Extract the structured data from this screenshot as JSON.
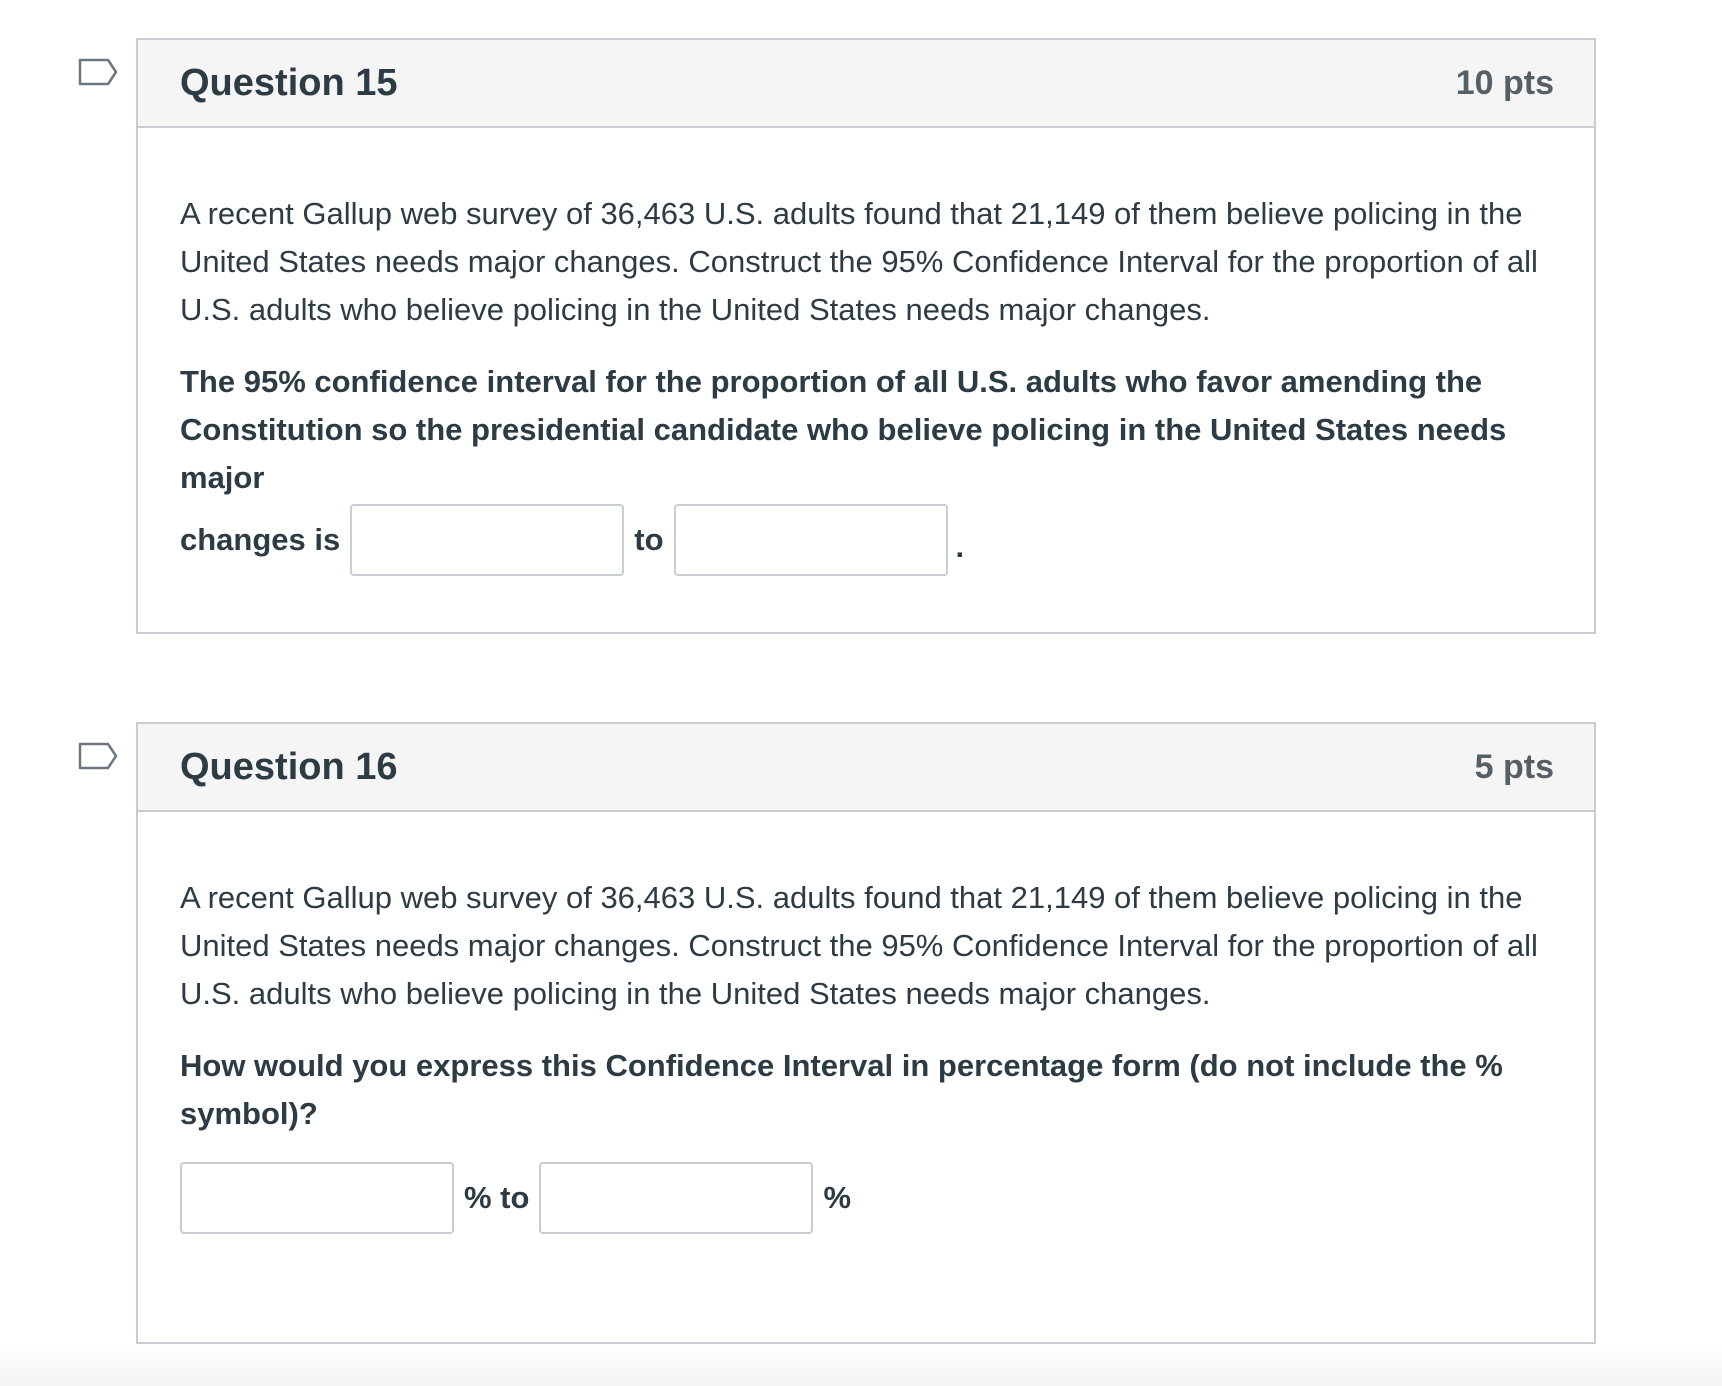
{
  "questions": [
    {
      "title": "Question 15",
      "points": "10 pts",
      "text": "A recent Gallup web survey of 36,463 U.S. adults found that 21,149 of them believe policing in the United States needs major changes. Construct the 95% Confidence Interval for the proportion of all U.S. adults who believe policing in the United States needs major changes.",
      "prompt": "The 95% confidence interval for the proportion of all U.S. adults who favor amending the Constitution so the presidential candidate who believe policing in the United States needs major",
      "inline_lead": "changes is",
      "separator": "to",
      "trailing": ".",
      "answer1_value": "",
      "answer2_value": ""
    },
    {
      "title": "Question 16",
      "points": "5 pts",
      "text": "A recent Gallup web survey of 36,463 U.S. adults found that 21,149 of them believe policing in the United States needs major changes. Construct the 95% Confidence Interval for the proportion of all U.S. adults who believe policing in the United States needs major changes.",
      "prompt": "How would you express this Confidence Interval in percentage form (do not include the % symbol)?",
      "separator": "% to",
      "trailing": "%",
      "answer1_value": "",
      "answer2_value": ""
    }
  ],
  "colors": {
    "border": "#c7cdd1",
    "header_bg": "#f5f5f5",
    "text": "#2d3b45",
    "flag": "#6b7780"
  },
  "icons": {
    "flag": "flag-outline-icon"
  }
}
